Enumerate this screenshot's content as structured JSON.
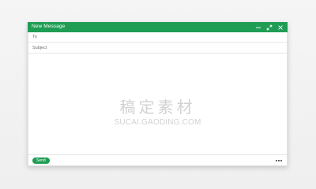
{
  "window": {
    "title": "New Message",
    "controls": {
      "minimize_icon": "minimize-icon",
      "expand_icon": "expand-icon",
      "close_icon": "close-icon"
    }
  },
  "fields": {
    "to_label": "To",
    "subject_label": "Subject"
  },
  "watermark": {
    "cn": "稿定素材",
    "en": "SUCAI.GAODING.COM"
  },
  "footer": {
    "send_label": "Send",
    "more_icon": "more-horizontal-icon"
  },
  "colors": {
    "accent": "#1f9d55",
    "background": "#f3f3f3"
  }
}
